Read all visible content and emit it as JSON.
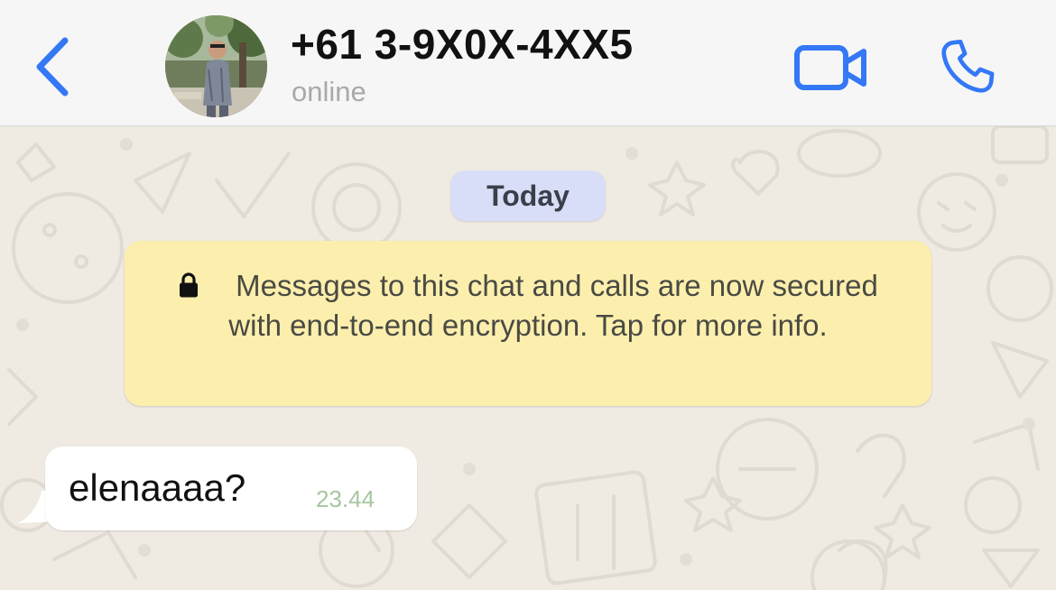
{
  "header": {
    "contact_name": "+61 3-9X0X-4XX5",
    "status": "online",
    "back_icon": "chevron-left-icon",
    "video_icon": "video-camera-icon",
    "call_icon": "phone-icon",
    "accent_color": "#3478f6"
  },
  "chat": {
    "date_label": "Today",
    "encryption_notice": "Messages to this chat and calls are now secured with end-to-end encryption. Tap for more info.",
    "messages": [
      {
        "text": "elenaaaa?",
        "time": "23.44",
        "direction": "incoming"
      }
    ]
  },
  "colors": {
    "wallpaper": "#efeae2",
    "notice_bg": "#fcefad",
    "date_pill_bg": "#d8def7",
    "timestamp": "#a8c6a0"
  }
}
